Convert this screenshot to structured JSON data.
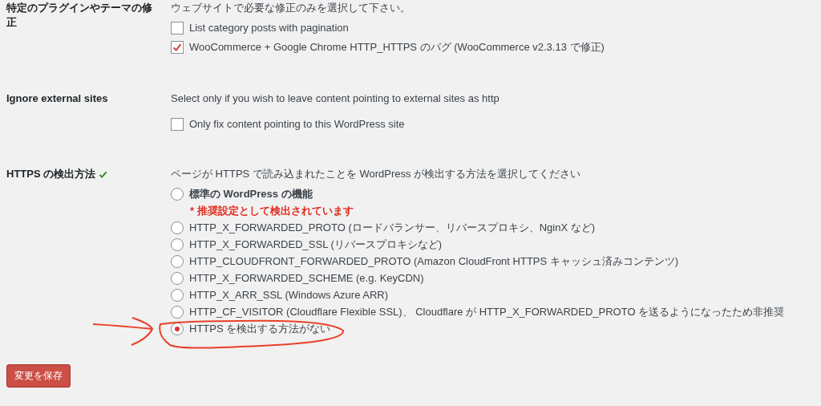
{
  "sections": [
    {
      "label": "特定のプラグインやテーマの修正",
      "verified": false,
      "description": "ウェブサイトで必要な修正のみを選択して下さい。",
      "options": [
        {
          "kind": "checkbox",
          "label": "List category posts with pagination",
          "checked": false
        },
        {
          "kind": "checkbox",
          "label": "WooCommerce + Google Chrome HTTP_HTTPS のバグ (WooCommerce v2.3.13 で修正)",
          "checked": true
        }
      ]
    },
    {
      "label": "Ignore external sites",
      "verified": false,
      "description": "Select only if you wish to leave content pointing to external sites as http",
      "options": [
        {
          "kind": "checkbox",
          "label": "Only fix content pointing to this WordPress site",
          "checked": false
        }
      ]
    },
    {
      "label": "HTTPS の検出方法",
      "verified": true,
      "description": "ページが HTTPS で読み込まれたことを WordPress が検出する方法を選択してください",
      "options": [
        {
          "kind": "radio",
          "label": "標準の WordPress の機能",
          "strong": true,
          "note": "* 推奨設定として検出されています",
          "selected": false
        },
        {
          "kind": "radio",
          "label": "HTTP_X_FORWARDED_PROTO (ロードバランサー、リバースプロキシ、NginX など)",
          "strong": false,
          "selected": false
        },
        {
          "kind": "radio",
          "label": "HTTP_X_FORWARDED_SSL (リバースプロキシなど)",
          "strong": false,
          "selected": false
        },
        {
          "kind": "radio",
          "label": "HTTP_CLOUDFRONT_FORWARDED_PROTO (Amazon CloudFront HTTPS キャッシュ済みコンテンツ)",
          "strong": false,
          "selected": false
        },
        {
          "kind": "radio",
          "label": "HTTP_X_FORWARDED_SCHEME (e.g. KeyCDN)",
          "strong": false,
          "selected": false
        },
        {
          "kind": "radio",
          "label": "HTTP_X_ARR_SSL (Windows Azure ARR)",
          "strong": false,
          "selected": false
        },
        {
          "kind": "radio",
          "label": "HTTP_CF_VISITOR (Cloudflare Flexible SSL)、 Cloudflare が HTTP_X_FORWARDED_PROTO を送るようになったため非推奨",
          "strong": false,
          "selected": false
        },
        {
          "kind": "radio",
          "label": "HTTPS を検出する方法がない",
          "strong": false,
          "selected": true
        }
      ]
    }
  ],
  "save_button": "変更を保存"
}
